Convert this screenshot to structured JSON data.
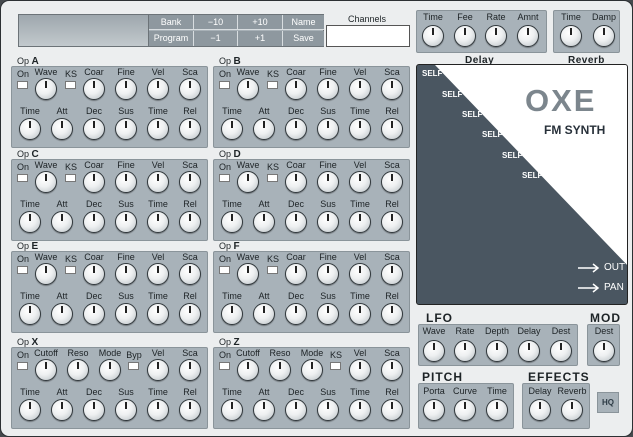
{
  "patch": {
    "bank": "Bank",
    "program": "Program",
    "minus10": "−10",
    "plus10": "+10",
    "minus1": "−1",
    "plus1": "+1",
    "name": "Name",
    "save": "Save"
  },
  "channels": {
    "label": "Channels",
    "value": ""
  },
  "delay": {
    "title": "Delay",
    "labels": [
      "Time",
      "Fee",
      "Rate",
      "Amnt"
    ]
  },
  "reverb": {
    "title": "Reverb",
    "labels": [
      "Time",
      "Damp"
    ]
  },
  "op_prefix": "Op",
  "operators": [
    {
      "letter": "A"
    },
    {
      "letter": "B"
    },
    {
      "letter": "C"
    },
    {
      "letter": "D"
    },
    {
      "letter": "E"
    },
    {
      "letter": "F"
    }
  ],
  "op_labels": {
    "on": "On",
    "wave": "Wave",
    "ks": "KS",
    "coar": "Coar",
    "fine": "Fine",
    "vel": "Vel",
    "sca": "Sca",
    "time": "Time",
    "att": "Att",
    "dec": "Dec",
    "sus": "Sus",
    "rel": "Rel"
  },
  "filter_ops": [
    {
      "letter": "X",
      "top": [
        "Cutoff",
        "Reso",
        "Mode"
      ],
      "byp": "Byp"
    },
    {
      "letter": "Z",
      "top": [
        "Cutoff",
        "Reso",
        "Mode"
      ],
      "ks": "KS"
    }
  ],
  "diagram": {
    "self_labels": [
      "SELF",
      "SELF",
      "SELF",
      "SELF",
      "SELF",
      "SELF"
    ],
    "logo": "OXE",
    "subtitle": "FM SYNTH",
    "out": "OUT",
    "pan": "PAN"
  },
  "lfo": {
    "title": "LFO",
    "labels": [
      "Wave",
      "Rate",
      "Depth",
      "Delay",
      "Dest"
    ]
  },
  "mod": {
    "title": "MOD",
    "labels": [
      "Dest"
    ]
  },
  "pitch": {
    "title": "PITCH",
    "labels": [
      "Porta",
      "Curve",
      "Time"
    ]
  },
  "effects": {
    "title": "EFFECTS",
    "labels": [
      "Delay",
      "Reverb"
    ]
  },
  "hq": "HQ"
}
